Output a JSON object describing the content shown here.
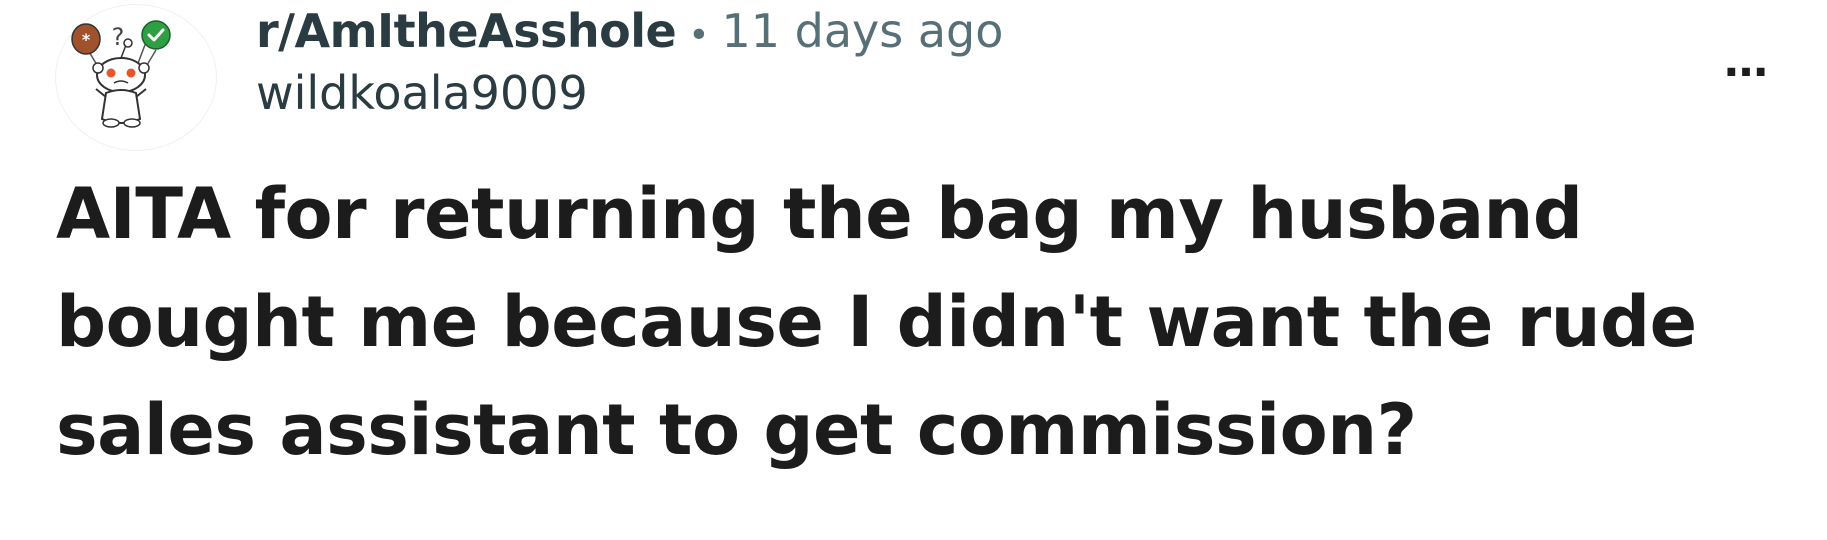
{
  "post": {
    "subreddit": "r/AmItheAsshole",
    "separator": "•",
    "time_ago": "11 days ago",
    "author": "wildkoala9009",
    "overflow_icon": "…",
    "title": "AITA for returning the bag my husband bought me because I didn't want the rude sales assistant to get commission?"
  },
  "icons": {
    "avatar": "snoo-avatar-icon",
    "overflow": "more-options-icon"
  },
  "colors": {
    "subreddit_text": "#2a3c42",
    "meta_text": "#576f76",
    "title_text": "#1c1c1c",
    "avatar_accent_orange": "#e8552b",
    "avatar_accent_green": "#2ea043"
  }
}
